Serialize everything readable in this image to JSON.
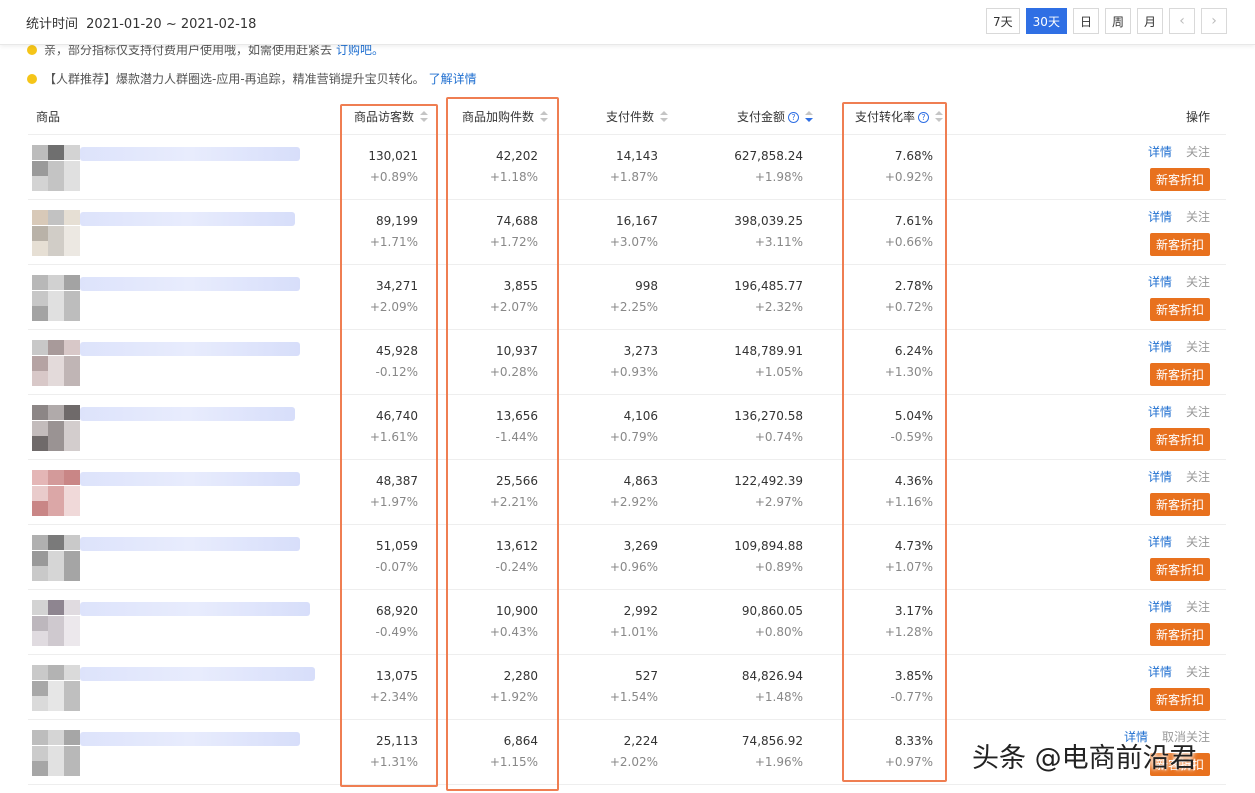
{
  "header": {
    "period_label": "统计时间",
    "period_range": "2021-01-20 ~ 2021-02-18",
    "buttons": [
      "7天",
      "30天",
      "日",
      "周",
      "月"
    ],
    "active": "30天",
    "prev": "‹",
    "next": "›"
  },
  "notices": [
    {
      "text": "亲，部分指标仅支持付费用户使用哦，如需使用赶紧去",
      "link": "订购吧。"
    },
    {
      "text": "【人群推荐】爆款潜力人群圈选-应用-再追踪，精准营销提升宝贝转化。",
      "link": "了解详情"
    }
  ],
  "table": {
    "columns": [
      "商品",
      "商品访客数",
      "商品加购件数",
      "支付件数",
      "支付金额",
      "支付转化率",
      "操作"
    ],
    "rows": [
      {
        "visitors": "130,021",
        "visitors_d": "+0.89%",
        "cart": "42,202",
        "cart_d": "+1.18%",
        "qty": "14,143",
        "qty_d": "+1.87%",
        "amount": "627,858.24",
        "amount_d": "+1.98%",
        "cvr": "7.68%",
        "cvr_d": "+0.92%",
        "detail": "详情",
        "follow": "关注",
        "promo": "新客折扣"
      },
      {
        "visitors": "89,199",
        "visitors_d": "+1.71%",
        "cart": "74,688",
        "cart_d": "+1.72%",
        "qty": "16,167",
        "qty_d": "+3.07%",
        "amount": "398,039.25",
        "amount_d": "+3.11%",
        "cvr": "7.61%",
        "cvr_d": "+0.66%",
        "detail": "详情",
        "follow": "关注",
        "promo": "新客折扣"
      },
      {
        "visitors": "34,271",
        "visitors_d": "+2.09%",
        "cart": "3,855",
        "cart_d": "+2.07%",
        "qty": "998",
        "qty_d": "+2.25%",
        "amount": "196,485.77",
        "amount_d": "+2.32%",
        "cvr": "2.78%",
        "cvr_d": "+0.72%",
        "detail": "详情",
        "follow": "关注",
        "promo": "新客折扣"
      },
      {
        "visitors": "45,928",
        "visitors_d": "-0.12%",
        "cart": "10,937",
        "cart_d": "+0.28%",
        "qty": "3,273",
        "qty_d": "+0.93%",
        "amount": "148,789.91",
        "amount_d": "+1.05%",
        "cvr": "6.24%",
        "cvr_d": "+1.30%",
        "detail": "详情",
        "follow": "关注",
        "promo": "新客折扣"
      },
      {
        "visitors": "46,740",
        "visitors_d": "+1.61%",
        "cart": "13,656",
        "cart_d": "-1.44%",
        "qty": "4,106",
        "qty_d": "+0.79%",
        "amount": "136,270.58",
        "amount_d": "+0.74%",
        "cvr": "5.04%",
        "cvr_d": "-0.59%",
        "detail": "详情",
        "follow": "关注",
        "promo": "新客折扣"
      },
      {
        "visitors": "48,387",
        "visitors_d": "+1.97%",
        "cart": "25,566",
        "cart_d": "+2.21%",
        "qty": "4,863",
        "qty_d": "+2.92%",
        "amount": "122,492.39",
        "amount_d": "+2.97%",
        "cvr": "4.36%",
        "cvr_d": "+1.16%",
        "detail": "详情",
        "follow": "关注",
        "promo": "新客折扣"
      },
      {
        "visitors": "51,059",
        "visitors_d": "-0.07%",
        "cart": "13,612",
        "cart_d": "-0.24%",
        "qty": "3,269",
        "qty_d": "+0.96%",
        "amount": "109,894.88",
        "amount_d": "+0.89%",
        "cvr": "4.73%",
        "cvr_d": "+1.07%",
        "detail": "详情",
        "follow": "关注",
        "promo": "新客折扣"
      },
      {
        "visitors": "68,920",
        "visitors_d": "-0.49%",
        "cart": "10,900",
        "cart_d": "+0.43%",
        "qty": "2,992",
        "qty_d": "+1.01%",
        "amount": "90,860.05",
        "amount_d": "+0.80%",
        "cvr": "3.17%",
        "cvr_d": "+1.28%",
        "detail": "详情",
        "follow": "关注",
        "promo": "新客折扣"
      },
      {
        "visitors": "13,075",
        "visitors_d": "+2.34%",
        "cart": "2,280",
        "cart_d": "+1.92%",
        "qty": "527",
        "qty_d": "+1.54%",
        "amount": "84,826.94",
        "amount_d": "+1.48%",
        "cvr": "3.85%",
        "cvr_d": "-0.77%",
        "detail": "详情",
        "follow": "关注",
        "promo": "新客折扣"
      },
      {
        "visitors": "25,113",
        "visitors_d": "+1.31%",
        "cart": "6,864",
        "cart_d": "+1.15%",
        "qty": "2,224",
        "qty_d": "+2.02%",
        "amount": "74,856.92",
        "amount_d": "+1.96%",
        "cvr": "8.33%",
        "cvr_d": "+0.97%",
        "detail": "详情",
        "follow": "取消关注",
        "promo": "新客折扣"
      }
    ]
  },
  "watermark": "头条 @电商前沿君",
  "colors": {
    "accent": "#2f6fe4",
    "highlight_box": "#ef7e52",
    "promo": "#e8711e",
    "link": "#1f6fd0"
  }
}
